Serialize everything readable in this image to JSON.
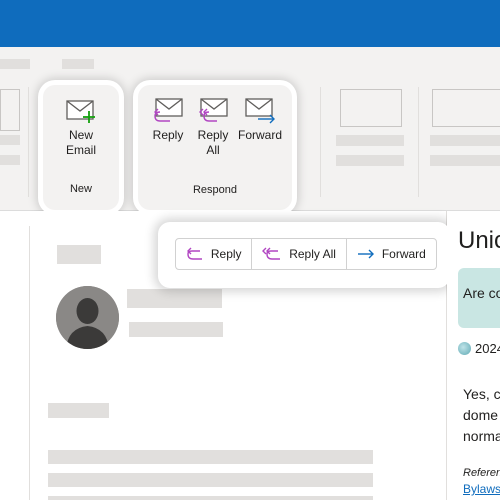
{
  "ribbon": {
    "new_group": {
      "button_label_line1": "New",
      "button_label_line2": "Email",
      "group_label": "New"
    },
    "respond_group": {
      "reply_label": "Reply",
      "reply_all_line1": "Reply",
      "reply_all_line2": "All",
      "forward_label": "Forward",
      "group_label": "Respond"
    }
  },
  "message_toolbar": {
    "reply_label": "Reply",
    "reply_all_label": "Reply All",
    "forward_label": "Forward"
  },
  "right_panel": {
    "title_fragment": "Unic",
    "banner_fragment": "Are co",
    "date_fragment": "2024",
    "body_lines": [
      "Yes, c",
      "dome",
      "norma"
    ],
    "reference_label": "Referen",
    "link_text": "Bylaws"
  },
  "colors": {
    "topbar": "#0f6cbd",
    "reply_icon": "#b146c2",
    "forward_icon": "#0f6cbd",
    "new_plus": "#13a10e",
    "banner": "#c9e6e3",
    "link": "#0f6cbd"
  }
}
